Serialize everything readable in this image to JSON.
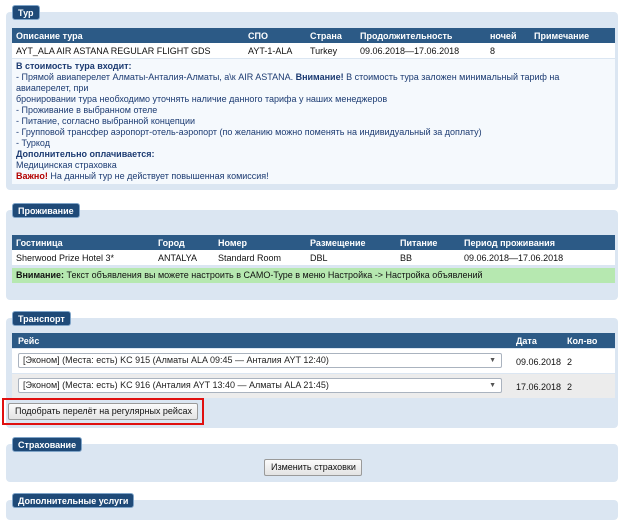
{
  "tour": {
    "legend": "Тур",
    "columns": [
      "Описание тура",
      "СПО",
      "Страна",
      "Продолжительность",
      "ночей",
      "Примечание"
    ],
    "row": [
      "AYT_ALA AIR ASTANA REGULAR FLIGHT GDS",
      "AYT-1-ALA",
      "Turkey",
      "09.06.2018—17.06.2018",
      "8",
      ""
    ],
    "includes_title": "В стоимость тура входит:",
    "line1_a": "- Прямой авиаперелет Алматы-Анталия-Алматы, а\\к AIR ASTANA.",
    "line1_b": "Внимание!",
    "line1_c": " В стоимость тура заложен минимальный тариф  на авиаперелет, при",
    "line2": "бронировании тура необходимо уточнять  наличие данного тарифа у наших менеджеров",
    "line3": "- Проживание в выбранном отеле",
    "line4": "- Питание, согласно выбранной концепции",
    "line5": "- Групповой трансфер аэропорт-отель-аэропорт (по желанию можно поменять на индивидуальный за доплату)",
    "line6": "- Туркод",
    "extra_title": "Дополнительно оплачивается:",
    "line7": " Медицинская страховка",
    "important_label": "Важно!",
    "important_text": " На данный тур  не действует повышенная комиссия!"
  },
  "accommodation": {
    "legend": "Проживание",
    "columns": [
      "Гостиница",
      "Город",
      "Номер",
      "Размещение",
      "Питание",
      "Период проживания"
    ],
    "row": [
      "Sherwood Prize Hotel 3*",
      "ANTALYA",
      "Standard Room",
      "DBL",
      "BB",
      "09.06.2018—17.06.2018"
    ],
    "note_label": "Внимание:",
    "note_text": " Текст объявления вы можете настроить в САМО-Туре в меню Настройка -> Настройка объявлений"
  },
  "transport": {
    "legend": "Транспорт",
    "columns": [
      "Рейс",
      "Дата",
      "Кол-во"
    ],
    "flights": [
      {
        "label": "[Эконом] (Места: есть) KC 915 (Алматы ALA 09:45 — Анталия AYT 12:40)",
        "date": "09.06.2018",
        "qty": "2"
      },
      {
        "label": "[Эконом] (Места: есть) KC 916 (Анталия AYT 13:40 — Алматы ALA 21:45)",
        "date": "17.06.2018",
        "qty": "2"
      }
    ],
    "find_button": "Подобрать перелёт на регулярных рейсах"
  },
  "insurance": {
    "legend": "Страхование",
    "button": "Изменить страховки"
  },
  "extra_services": {
    "legend": "Дополнительные услуги"
  },
  "colors": {
    "header": "#2c5a86",
    "panel": "#dbe6f2",
    "note_green": "#b6e8b0",
    "highlight_red": "#e01010"
  }
}
